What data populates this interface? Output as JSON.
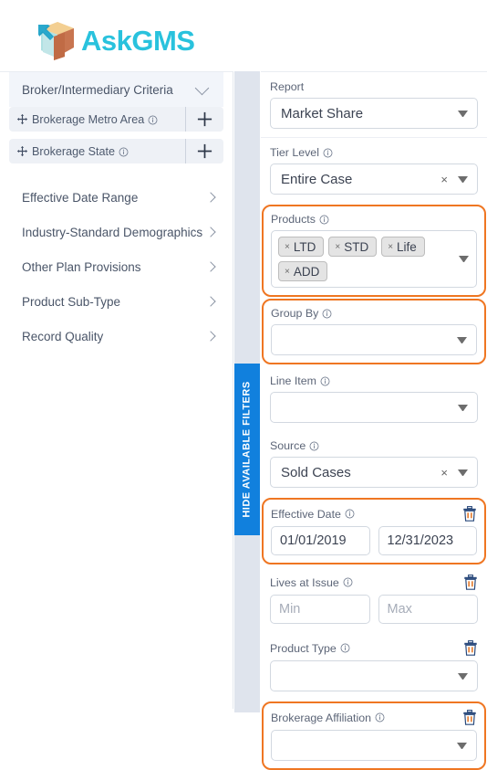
{
  "brand": {
    "name": "AskGMS",
    "color": "#29c2dd",
    "logo_icon": "box-cube-logo"
  },
  "sidebar": {
    "accordion": {
      "label": "Broker/Intermediary Criteria",
      "icon": "chevron-down-icon",
      "expanded": true
    },
    "selected_criteria": [
      {
        "label": "Brokerage Metro Area",
        "drag_icon": "move-arrows-icon",
        "info_icon": "info-circle-icon",
        "add_icon": "plus-icon"
      },
      {
        "label": "Brokerage State",
        "drag_icon": "move-arrows-icon",
        "info_icon": "info-circle-icon",
        "add_icon": "plus-icon"
      }
    ],
    "nav_items": [
      {
        "label": "Effective Date Range",
        "icon": "chevron-right-icon"
      },
      {
        "label": "Industry-Standard Demographics",
        "icon": "chevron-right-icon"
      },
      {
        "label": "Other Plan Provisions",
        "icon": "chevron-right-icon"
      },
      {
        "label": "Product Sub-Type",
        "icon": "chevron-right-icon"
      },
      {
        "label": "Record Quality",
        "icon": "chevron-right-icon"
      }
    ]
  },
  "hide_tab": {
    "label": "HIDE AVAILABLE FILTERS",
    "color": "#1180dd"
  },
  "highlight_color": "#ef7622",
  "filters": {
    "report": {
      "label": "Report",
      "value": "Market Share",
      "caret_icon": "caret-down-icon",
      "highlighted": false,
      "has_info": false,
      "has_clear": false,
      "has_trash": false
    },
    "tier_level": {
      "label": "Tier Level",
      "value": "Entire Case",
      "info_icon": "info-circle-icon",
      "clear_icon": "clear-x-icon",
      "caret_icon": "caret-down-icon",
      "highlighted": false,
      "has_info": true,
      "has_clear": true,
      "has_trash": false
    },
    "products": {
      "label": "Products",
      "info_icon": "info-circle-icon",
      "chips": [
        "LTD",
        "STD",
        "Life",
        "ADD"
      ],
      "chip_remove_icon": "chip-x-icon",
      "caret_icon": "caret-down-icon",
      "highlighted": true
    },
    "group_by": {
      "label": "Group By",
      "value": "",
      "info_icon": "info-circle-icon",
      "caret_icon": "caret-down-icon",
      "highlighted": true
    },
    "line_item": {
      "label": "Line Item",
      "value": "",
      "info_icon": "info-circle-icon",
      "caret_icon": "caret-down-icon",
      "highlighted": false
    },
    "source": {
      "label": "Source",
      "value": "Sold Cases",
      "info_icon": "info-circle-icon",
      "clear_icon": "clear-x-icon",
      "caret_icon": "caret-down-icon",
      "highlighted": false,
      "has_clear": true
    },
    "effective_date": {
      "label": "Effective Date",
      "info_icon": "info-circle-icon",
      "trash_icon": "trash-icon",
      "from_value": "01/01/2019",
      "to_value": "12/31/2023",
      "from_placeholder": "",
      "to_placeholder": "",
      "highlighted": true
    },
    "lives_at_issue": {
      "label": "Lives at Issue",
      "info_icon": "info-circle-icon",
      "trash_icon": "trash-icon",
      "min_value": "",
      "max_value": "",
      "min_placeholder": "Min",
      "max_placeholder": "Max",
      "highlighted": false
    },
    "product_type": {
      "label": "Product Type",
      "value": "",
      "info_icon": "info-circle-icon",
      "trash_icon": "trash-icon",
      "caret_icon": "caret-down-icon",
      "highlighted": false
    },
    "brokerage_affiliation": {
      "label": "Brokerage Affiliation",
      "value": "",
      "info_icon": "info-circle-icon",
      "trash_icon": "trash-icon",
      "caret_icon": "caret-down-icon",
      "highlighted": true
    }
  }
}
